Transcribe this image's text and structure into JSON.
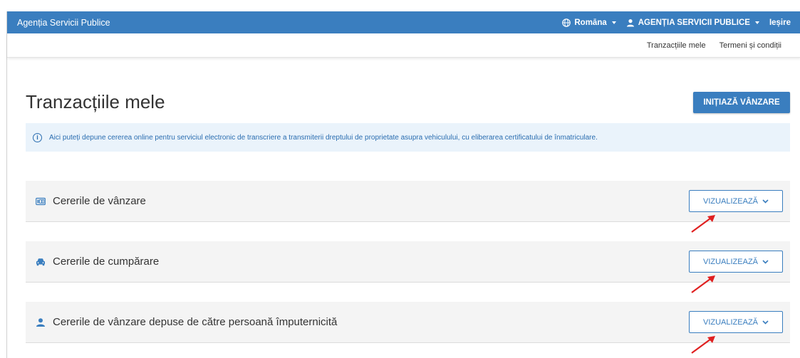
{
  "header": {
    "brand": "Agenția Servicii Publice",
    "language": "Romāna",
    "account": "AGENȚIA SERVICII PUBLICE",
    "logout": "Ieșire"
  },
  "subnav": {
    "items": [
      "Tranzacțiile mele",
      "Termeni și condiții"
    ]
  },
  "main": {
    "title": "Tranzacțiile mele",
    "primary_button": "INIȚIAZĂ VÂNZARE",
    "info_text": "Aici puteți depune cererea online pentru serviciul electronic de transcriere a transmiterii dreptului de proprietate asupra vehiculului, cu eliberarea certificatului de înmatriculare.",
    "sections": [
      {
        "label": "Cererile de vânzare",
        "icon": "id-card-icon",
        "button": "VIZUALIZEAZĂ"
      },
      {
        "label": "Cererile de cumpărare",
        "icon": "car-icon",
        "button": "VIZUALIZEAZĂ"
      },
      {
        "label": "Cererile de vânzare depuse de către persoană împuternicită",
        "icon": "person-icon",
        "button": "VIZUALIZEAZĂ"
      }
    ]
  },
  "colors": {
    "primary": "#3a7ebf",
    "info_bg": "#eaf3fb",
    "section_bg": "#f4f4f4",
    "annotation_arrow": "#e02020"
  }
}
